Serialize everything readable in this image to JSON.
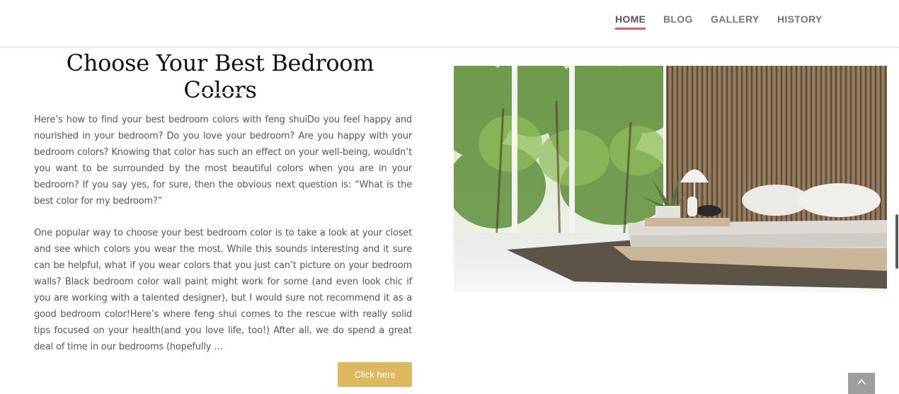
{
  "nav": {
    "items": [
      {
        "label": "HOME",
        "active": true
      },
      {
        "label": "BLOG",
        "active": false
      },
      {
        "label": "GALLERY",
        "active": false
      },
      {
        "label": "HISTORY",
        "active": false
      }
    ],
    "accent": "#e8595c"
  },
  "article": {
    "title": "Choose Your Best Bedroom Colors",
    "paragraphs": [
      "Here’s how to find your best bedroom colors with feng shuiDo you feel happy and nourished in your bedroom? Do you love your bedroom? Are you happy with your bedroom colors? Knowing that color has such an effect on your well-being, wouldn’t you want to be surrounded by the most beautiful colors when you are in your bedroom? If you say yes, for sure, then the obvious next question is: “What is the best color for my bedroom?”",
      "One popular way to choose your best bedroom color is to take a look at your closet and see which colors you wear the most. While this sounds interesting and it sure can be helpful, what if you wear colors that you just can’t picture on your bedroom walls? Black bedroom color wall paint might work for some (and even look chic if you are working with a talented designer), but I would sure not recommend it as a good bedroom color!Here’s where feng shui comes to the rescue with really solid tips focused on your health(and you love life, too!) After all, we do spend a great deal of time in our bedrooms (hopefully …"
    ],
    "button_label": "Click here",
    "button_color": "#dfb95f"
  },
  "ui": {
    "scroll_top_icon": "chevron-up-icon"
  }
}
